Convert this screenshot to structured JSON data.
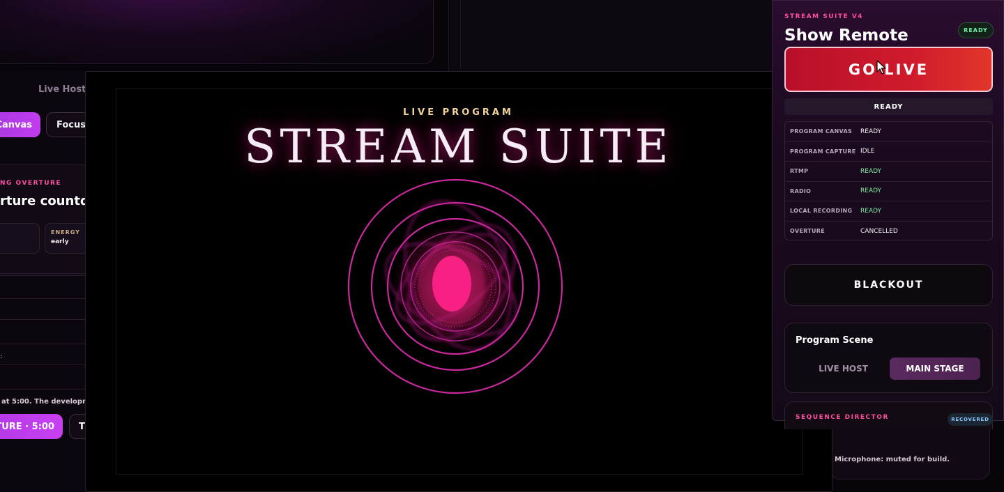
{
  "background": {
    "live_host": "Live Host",
    "canvas_button": "Canvas",
    "focus_button": "Focus",
    "overture_kicker": "NG OVERTURE",
    "overture_title": "rture countdo",
    "energy_label": "ENERGY",
    "energy_value": "early",
    "colon": ":",
    "dev_text": "at 5:00. The developm",
    "overture_button": "TURE · 5:00",
    "t_button": "T",
    "mic_text": "Microphone: muted for build."
  },
  "program": {
    "kicker": "LIVE PROGRAM",
    "title": "STREAM SUITE"
  },
  "remote": {
    "kicker": "STREAM SUITE V4",
    "title": "Show Remote",
    "ready_pill": "READY",
    "go_live": "GO LIVE",
    "status": "READY",
    "rows": [
      {
        "key": "PROGRAM CANVAS",
        "value": "READY"
      },
      {
        "key": "PROGRAM CAPTURE",
        "value": "IDLE"
      },
      {
        "key": "RTMP",
        "value": "READY"
      },
      {
        "key": "RADIO",
        "value": "READY"
      },
      {
        "key": "LOCAL RECORDING",
        "value": "READY"
      },
      {
        "key": "OVERTURE",
        "value": "CANCELLED"
      }
    ],
    "blackout": "BLACKOUT",
    "scene": {
      "title": "Program Scene",
      "options": [
        "LIVE HOST",
        "MAIN STAGE"
      ],
      "selected": "MAIN STAGE"
    },
    "sequence": {
      "kicker": "SEQUENCE DIRECTOR",
      "pill": "RECOVERED"
    }
  },
  "colors": {
    "accent_pink": "#ff4fa0",
    "go_live_red": "#d01a2c",
    "ready_green": "#7ef0a2",
    "gold": "#f2d79c"
  },
  "icons": {
    "cursor": "mouse-pointer-icon"
  }
}
